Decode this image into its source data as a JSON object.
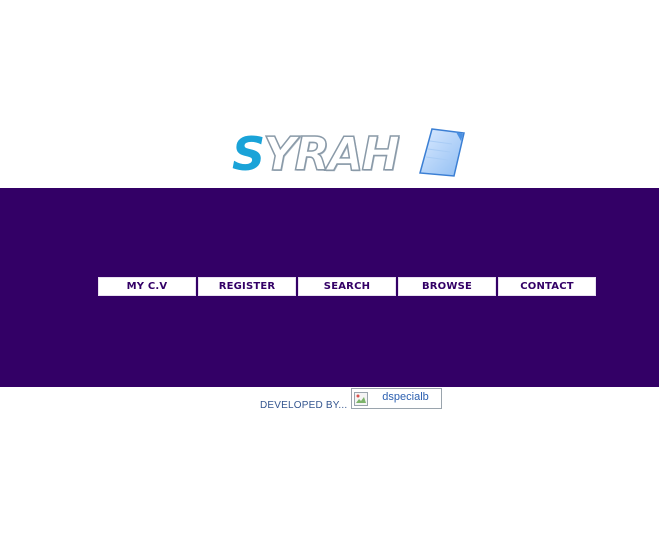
{
  "logo": {
    "first_letter": "S",
    "rest": "YRAH",
    "icon": "document-page-icon",
    "colors": {
      "accent": "#1aa3d8",
      "outline": "#8a9aa8"
    }
  },
  "banner": {
    "background": "#330066"
  },
  "nav": {
    "items": [
      {
        "label": "MY C.V"
      },
      {
        "label": "REGISTER"
      },
      {
        "label": "SEARCH"
      },
      {
        "label": "BROWSE"
      },
      {
        "label": "CONTACT"
      }
    ]
  },
  "footer": {
    "developed_by": "DEVELOPED BY...",
    "badge_alt": "dspecialb",
    "badge_icon": "broken-image-icon"
  }
}
